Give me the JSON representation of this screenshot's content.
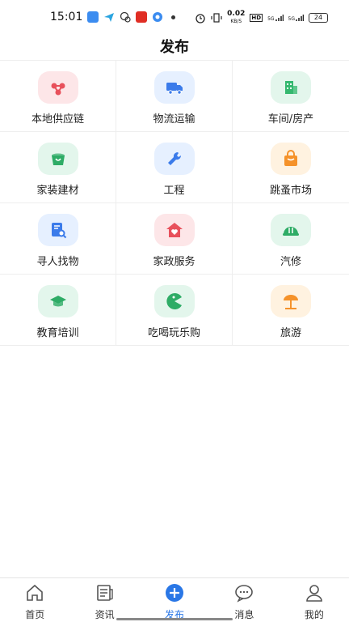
{
  "status": {
    "time": "15:01",
    "net_speed_value": "0.02",
    "net_speed_unit": "KB/S",
    "hd": "HD",
    "sig1": "5G",
    "sig2": "5G",
    "battery": "24"
  },
  "page": {
    "title": "发布"
  },
  "categories": [
    {
      "label": "本地供应链",
      "icon": "network-icon",
      "bg": "#fde6e8",
      "fg": "#e8505b"
    },
    {
      "label": "物流运输",
      "icon": "truck-icon",
      "bg": "#e6f0ff",
      "fg": "#3b7bea"
    },
    {
      "label": "车间/房产",
      "icon": "building-icon",
      "bg": "#e3f6ec",
      "fg": "#35b86f"
    },
    {
      "label": "家装建材",
      "icon": "bucket-icon",
      "bg": "#e3f6ec",
      "fg": "#2eac66"
    },
    {
      "label": "工程",
      "icon": "wrench-icon",
      "bg": "#e6f0ff",
      "fg": "#3b7bea"
    },
    {
      "label": "跳蚤市场",
      "icon": "bag-icon",
      "bg": "#fff2e0",
      "fg": "#f5922a"
    },
    {
      "label": "寻人找物",
      "icon": "search-doc-icon",
      "bg": "#e6f0ff",
      "fg": "#3b7bea"
    },
    {
      "label": "家政服务",
      "icon": "house-heart-icon",
      "bg": "#fde6e8",
      "fg": "#e8505b"
    },
    {
      "label": "汽修",
      "icon": "helmet-icon",
      "bg": "#e3f6ec",
      "fg": "#2eac66"
    },
    {
      "label": "教育培训",
      "icon": "graduation-cap-icon",
      "bg": "#e3f6ec",
      "fg": "#2eac66"
    },
    {
      "label": "吃喝玩乐购",
      "icon": "pacman-icon",
      "bg": "#e3f6ec",
      "fg": "#2eac66"
    },
    {
      "label": "旅游",
      "icon": "beach-umbrella-icon",
      "bg": "#fff2e0",
      "fg": "#f5922a"
    }
  ],
  "tabs": [
    {
      "label": "首页",
      "icon": "home-icon"
    },
    {
      "label": "资讯",
      "icon": "news-icon"
    },
    {
      "label": "发布",
      "icon": "add-circle-icon",
      "active": true
    },
    {
      "label": "消息",
      "icon": "message-icon"
    },
    {
      "label": "我的",
      "icon": "user-icon"
    }
  ],
  "colors": {
    "accent": "#2a77e6"
  }
}
